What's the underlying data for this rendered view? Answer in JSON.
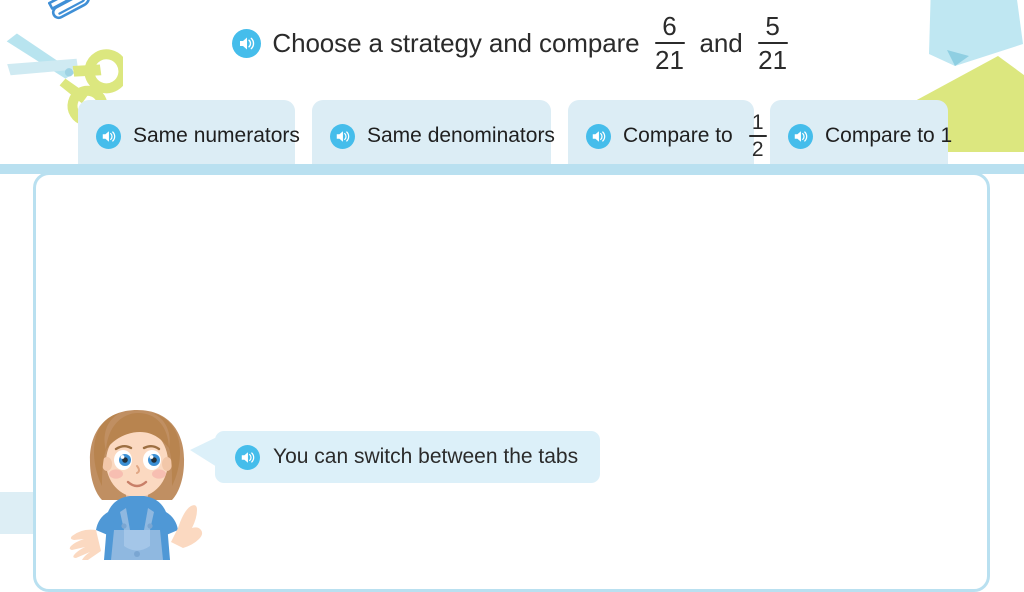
{
  "header": {
    "speaker_icon": "speaker-icon",
    "prompt_prefix": "Choose a strategy and compare",
    "conjunction": "and",
    "fraction_a": {
      "numerator": "6",
      "denominator": "21"
    },
    "fraction_b": {
      "numerator": "5",
      "denominator": "21"
    }
  },
  "tabs": [
    {
      "label": "Same numerators",
      "icon": "speaker-icon",
      "selected": false
    },
    {
      "label": "Same denominators",
      "icon": "speaker-icon",
      "selected": false
    },
    {
      "label": "Compare to",
      "icon": "speaker-icon",
      "selected": false,
      "fraction": {
        "numerator": "1",
        "denominator": "2"
      }
    },
    {
      "label": "Compare to 1",
      "icon": "speaker-icon",
      "selected": false
    }
  ],
  "hint": {
    "speaker_icon": "speaker-icon",
    "text": "You can switch between the tabs",
    "character": "girl-avatar"
  },
  "decorations": [
    {
      "name": "paperclip",
      "color": "#3f8fd6"
    },
    {
      "name": "scissors",
      "blade_color": "#b8e4ef",
      "handle_color": "#dce77f"
    },
    {
      "name": "sticky-note-blue",
      "color": "#bfe7f2"
    },
    {
      "name": "sticky-note-green",
      "color": "#dce77f"
    },
    {
      "name": "sticky-note-pale",
      "color": "#ddeef5"
    }
  ],
  "colors": {
    "accent": "#45bdeb",
    "tab_background": "#dcedf5",
    "panel_border": "#b9e0f0",
    "bubble_background": "#dcf0f9",
    "text": "#2b2b2b"
  }
}
